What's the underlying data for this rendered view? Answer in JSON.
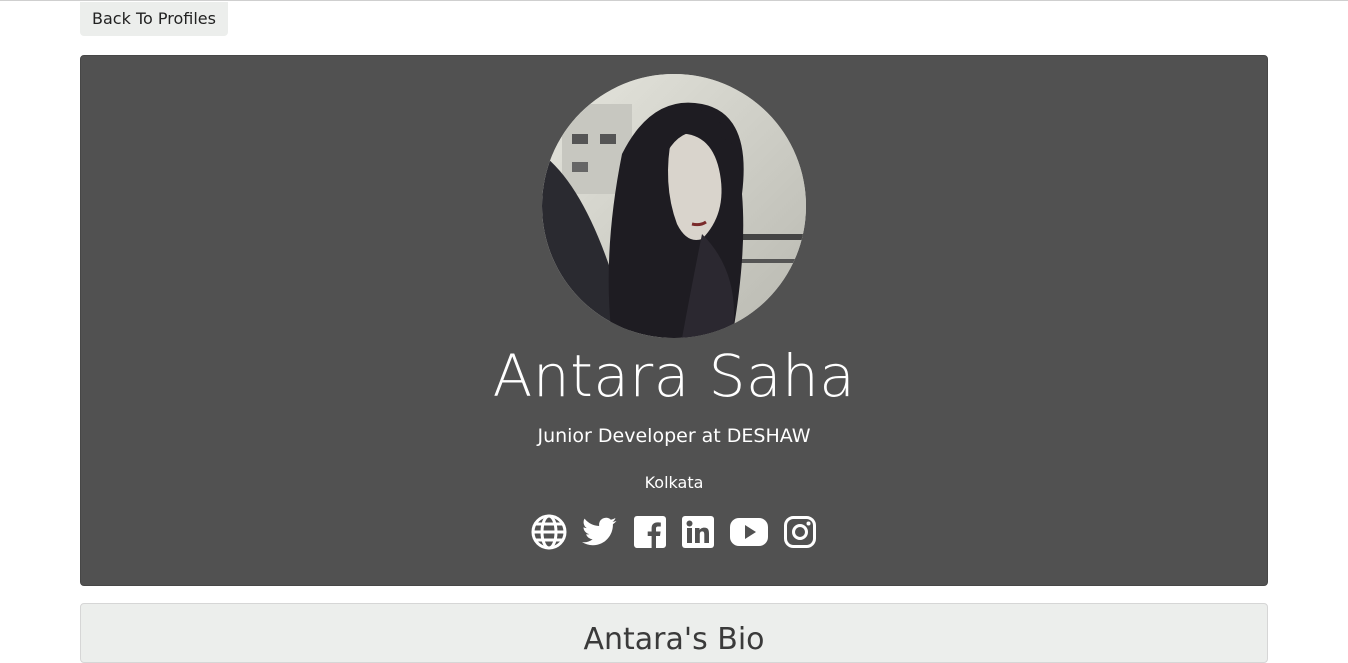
{
  "back_button_label": "Back To Profiles",
  "profile": {
    "name": "Antara Saha",
    "job_title": "Junior Developer at DESHAW",
    "location": "Kolkata",
    "avatar_alt": "Antara Saha profile photo"
  },
  "social_links": [
    {
      "icon": "globe-icon",
      "label": "Website"
    },
    {
      "icon": "twitter-icon",
      "label": "Twitter"
    },
    {
      "icon": "facebook-icon",
      "label": "Facebook"
    },
    {
      "icon": "linkedin-icon",
      "label": "LinkedIn"
    },
    {
      "icon": "youtube-icon",
      "label": "YouTube"
    },
    {
      "icon": "instagram-icon",
      "label": "Instagram"
    }
  ],
  "bio": {
    "title": "Antara's Bio"
  },
  "colors": {
    "profile_card_bg": "#515151",
    "light_card_bg": "#eceeec",
    "text_on_dark": "#ffffff"
  }
}
